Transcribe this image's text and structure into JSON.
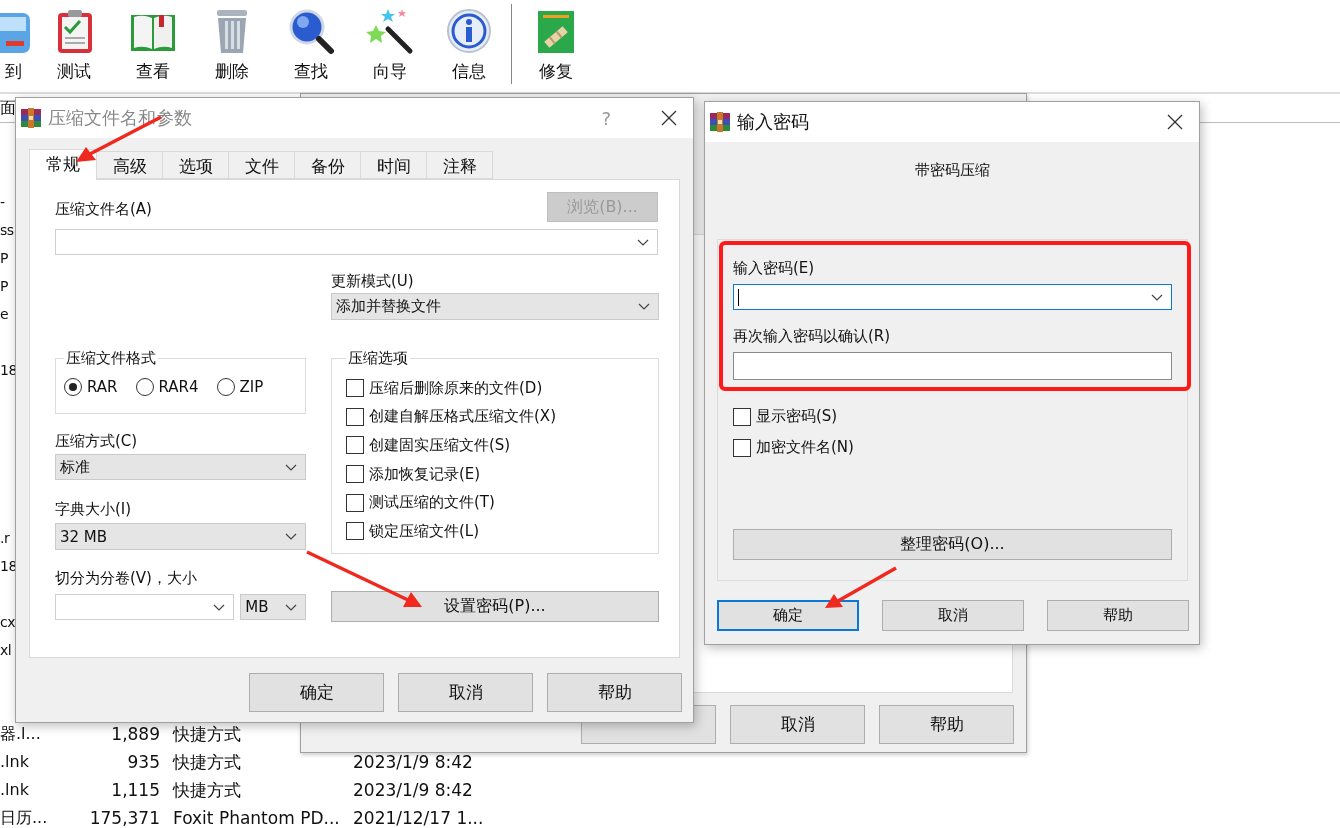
{
  "main_window": {
    "toolbar": {
      "groups": [
        [
          {
            "label": "到"
          },
          {
            "label": "测试"
          },
          {
            "label": "查看"
          },
          {
            "label": "删除"
          },
          {
            "label": "查找"
          },
          {
            "label": "向导"
          },
          {
            "label": "信息"
          }
        ],
        [
          {
            "label": "修复"
          }
        ]
      ]
    },
    "address_bar": {
      "path": "面"
    },
    "file_list": {
      "rows": [
        {
          "name": "-"
        },
        {
          "name": "ss"
        },
        {
          "name": "P"
        },
        {
          "name": "P"
        },
        {
          "name": "e"
        },
        {},
        {
          "name": "18"
        },
        {},
        {},
        {},
        {},
        {},
        {
          "name": ".r"
        },
        {
          "name": "18"
        },
        {},
        {
          "name": "cx"
        },
        {
          "name": "xl"
        },
        {},
        {},
        {
          "name": "器.l...",
          "size": "1,889",
          "type": "快捷方式"
        },
        {
          "name": ".lnk",
          "size": "935",
          "type": "快捷方式",
          "modified": "2023/1/9 8:42"
        },
        {
          "name": ".lnk",
          "size": "1,115",
          "type": "快捷方式",
          "modified": "2023/1/9 8:42"
        },
        {
          "name": "日历...",
          "size": "175,371",
          "type": "Foxit Phantom PD...",
          "modified": "2021/12/17 1..."
        }
      ]
    }
  },
  "background_dialog": {
    "buttons": [
      "取消",
      "帮助"
    ]
  },
  "archive_dialog": {
    "title": "压缩文件名和参数",
    "active": false,
    "help_button": "?",
    "tabs": [
      {
        "label": "常规",
        "selected": true
      },
      {
        "label": "高级",
        "selected": false
      },
      {
        "label": "选项",
        "selected": false
      },
      {
        "label": "文件",
        "selected": false
      },
      {
        "label": "备份",
        "selected": false
      },
      {
        "label": "时间",
        "selected": false
      },
      {
        "label": "注释",
        "selected": false
      }
    ],
    "archive_name": {
      "label": "压缩文件名(A)",
      "browse_button": {
        "label": "浏览(B)...",
        "disabled": true
      }
    },
    "update_mode": {
      "label": "更新模式(U)",
      "value": "添加并替换文件"
    },
    "format": {
      "title": "压缩文件格式",
      "options": [
        {
          "label": "RAR",
          "selected": true
        },
        {
          "label": "RAR4",
          "selected": false
        },
        {
          "label": "ZIP",
          "selected": false
        }
      ]
    },
    "method": {
      "label": "压缩方式(C)",
      "value": "标准"
    },
    "dictionary": {
      "label": "字典大小(I)",
      "value": "32 MB"
    },
    "split": {
      "label": "切分为分卷(V)，大小",
      "unit": "MB"
    },
    "options": {
      "title": "压缩选项",
      "items": [
        {
          "label": "压缩后删除原来的文件(D)",
          "checked": false
        },
        {
          "label": "创建自解压格式压缩文件(X)",
          "checked": false
        },
        {
          "label": "创建固实压缩文件(S)",
          "checked": false
        },
        {
          "label": "添加恢复记录(E)",
          "checked": false
        },
        {
          "label": "测试压缩的文件(T)",
          "checked": false
        },
        {
          "label": "锁定压缩文件(L)",
          "checked": false
        }
      ]
    },
    "password_button": "设置密码(P)...",
    "buttons": [
      "确定",
      "取消",
      "帮助"
    ]
  },
  "password_dialog": {
    "title": "输入密码",
    "active": true,
    "heading": "带密码压缩",
    "password": {
      "label": "输入密码(E)",
      "focused": true
    },
    "confirm": {
      "label": "再次输入密码以确认(R)"
    },
    "checkboxes": [
      {
        "label": "显示密码(S)",
        "checked": false
      },
      {
        "label": "加密文件名(N)",
        "checked": false
      }
    ],
    "organize_button": "整理密码(O)...",
    "buttons": [
      {
        "label": "确定",
        "default": true
      },
      {
        "label": "取消",
        "default": false
      },
      {
        "label": "帮助",
        "default": false
      }
    ]
  }
}
